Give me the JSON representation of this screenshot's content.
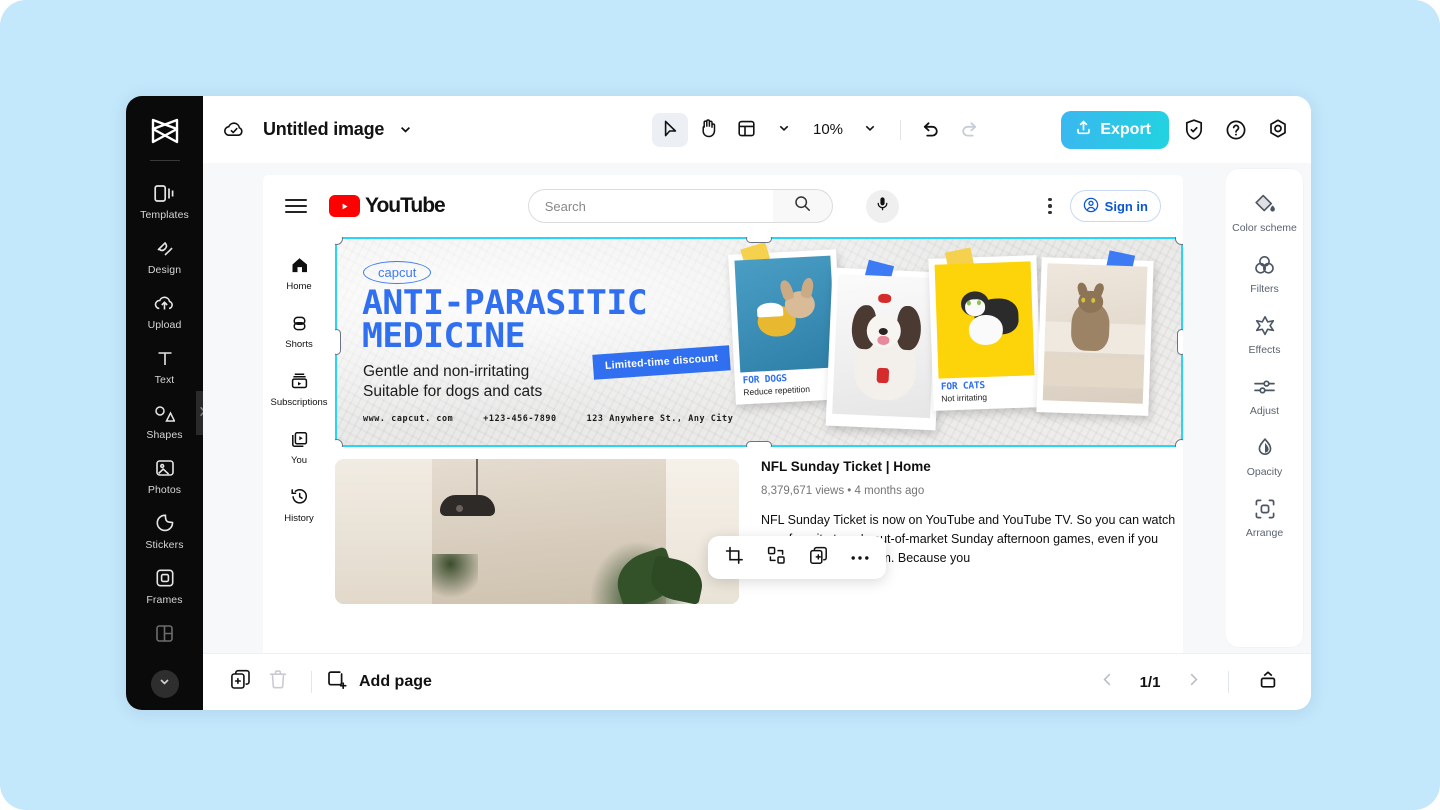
{
  "app": {
    "title": "Untitled image",
    "logo_icon": "capcut-logo-icon",
    "cloud_icon": "cloud-saved-icon",
    "title_chevron_icon": "chevron-down-icon"
  },
  "toolbar": {
    "select_tool": "select-arrow-icon",
    "hand_tool": "hand-pan-icon",
    "layout_tool": "layout-grid-icon",
    "layout_chevron": "chevron-down-icon",
    "zoom_value": "10%",
    "zoom_chevron": "chevron-down-icon",
    "undo_icon": "undo-icon",
    "redo_icon": "redo-icon",
    "export_label": "Export",
    "export_icon": "upload-icon",
    "export_gradient_from": "#3ab7f0",
    "export_gradient_to": "#22d3e0",
    "shield_icon": "shield-check-icon",
    "help_icon": "question-circle-icon",
    "settings_icon": "settings-gear-icon"
  },
  "left_rail": {
    "items": [
      {
        "label": "Templates",
        "icon": "templates-icon"
      },
      {
        "label": "Design",
        "icon": "design-icon"
      },
      {
        "label": "Upload",
        "icon": "upload-cloud-icon"
      },
      {
        "label": "Text",
        "icon": "text-t-icon"
      },
      {
        "label": "Shapes",
        "icon": "shapes-icon"
      },
      {
        "label": "Photos",
        "icon": "photos-image-icon"
      },
      {
        "label": "Stickers",
        "icon": "stickers-icon"
      },
      {
        "label": "Frames",
        "icon": "frames-icon"
      },
      {
        "label": "",
        "icon": "grid-layout-icon"
      }
    ],
    "expand_chevron_icon": "chevron-down-icon",
    "collapse_handle_icon": "chevron-right-icon"
  },
  "right_panel": {
    "items": [
      {
        "label": "Color scheme",
        "icon": "paint-bucket-icon"
      },
      {
        "label": "Filters",
        "icon": "filters-circles-icon"
      },
      {
        "label": "Effects",
        "icon": "effects-star-icon"
      },
      {
        "label": "Adjust",
        "icon": "adjust-sliders-icon"
      },
      {
        "label": "Opacity",
        "icon": "opacity-droplet-icon"
      },
      {
        "label": "Arrange",
        "icon": "arrange-frame-icon"
      }
    ]
  },
  "context_toolbar": {
    "items": [
      {
        "name": "crop",
        "icon": "crop-icon"
      },
      {
        "name": "replace",
        "icon": "replace-swap-icon"
      },
      {
        "name": "duplicate",
        "icon": "duplicate-icon"
      },
      {
        "name": "more",
        "icon": "more-dots-icon"
      }
    ]
  },
  "bottom_bar": {
    "duplicate_icon": "duplicate-page-icon",
    "delete_icon": "trash-icon",
    "add_page_label": "Add page",
    "add_page_icon": "add-page-icon",
    "prev_icon": "chevron-left-icon",
    "next_icon": "chevron-right-icon",
    "page_indicator": "1/1",
    "panel_toggle_icon": "pages-panel-icon"
  },
  "canvas": {
    "youtube_header": {
      "menu_icon": "hamburger-menu-icon",
      "logo_text": "YouTube",
      "logo_icon": "youtube-play-icon",
      "search_placeholder": "Search",
      "search_icon": "search-magnifier-icon",
      "mic_icon": "microphone-icon",
      "kebab_icon": "more-vertical-icon",
      "signin_label": "Sign in",
      "signin_icon": "account-circle-icon",
      "brand_red": "#ff0000",
      "signin_blue": "#0b57d0"
    },
    "youtube_sidebar": [
      {
        "label": "Home",
        "icon": "home-icon"
      },
      {
        "label": "Shorts",
        "icon": "shorts-icon"
      },
      {
        "label": "Subscriptions",
        "icon": "subscriptions-icon"
      },
      {
        "label": "You",
        "icon": "you-library-icon"
      },
      {
        "label": "History",
        "icon": "history-clock-icon"
      }
    ],
    "banner": {
      "brand_pill": "capcut",
      "headline_line1": "ANTI-PARASITIC",
      "headline_line2": "MEDICINE",
      "subline1": "Gentle and non-irritating",
      "subline2": "Suitable for dogs and cats",
      "ribbon": "Limited-time discount",
      "contact": [
        "www. capcut. com",
        "+123-456-7890",
        "123 Anywhere St., Any City"
      ],
      "accent_blue": "#2f6ff0",
      "photos": [
        {
          "caption_title": "FOR DOGS",
          "caption_sub": "Reduce repetition",
          "tape_color": "#f5d14e"
        },
        {
          "caption_title": "",
          "caption_sub": "",
          "tape_color": "#3d7bf5"
        },
        {
          "caption_title": "FOR CATS",
          "caption_sub": "Not irritating",
          "tape_color": "#f5d14e"
        },
        {
          "caption_title": "",
          "caption_sub": "",
          "tape_color": "#3d7bf5"
        }
      ]
    },
    "video": {
      "title": "NFL Sunday Ticket | Home",
      "meta": "8,379,671 views • 4 months ago",
      "description": "NFL Sunday Ticket is now on YouTube and YouTube TV. So you can watch your favorite team's out-of-market Sunday afternoon games, even if you live nowhere near them. Because you"
    },
    "selection": {
      "border_color": "#2ad4f5"
    }
  }
}
